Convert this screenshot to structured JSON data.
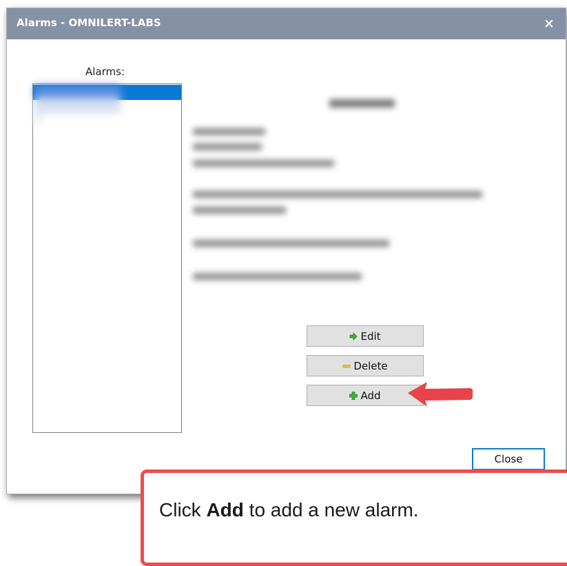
{
  "window": {
    "title": "Alarms - OMNILERT-LABS",
    "close_glyph": "×"
  },
  "alarm_list": {
    "label": "Alarms:"
  },
  "actions": {
    "edit_label": "Edit",
    "delete_label": "Delete",
    "add_label": "Add",
    "edit_icon": "green-arrow-right-icon",
    "delete_icon": "yellow-minus-icon",
    "add_icon": "green-plus-icon"
  },
  "footer": {
    "close_label": "Close"
  },
  "callout": {
    "text_before": "Click ",
    "text_bold": "Add",
    "text_after": " to add a new alarm."
  },
  "colors": {
    "titlebar": "#8591a5",
    "selection": "#0a7ad6",
    "close_button_border": "#0a78d7",
    "callout_border": "#ec4c4e",
    "arrow": "#e8434a"
  }
}
